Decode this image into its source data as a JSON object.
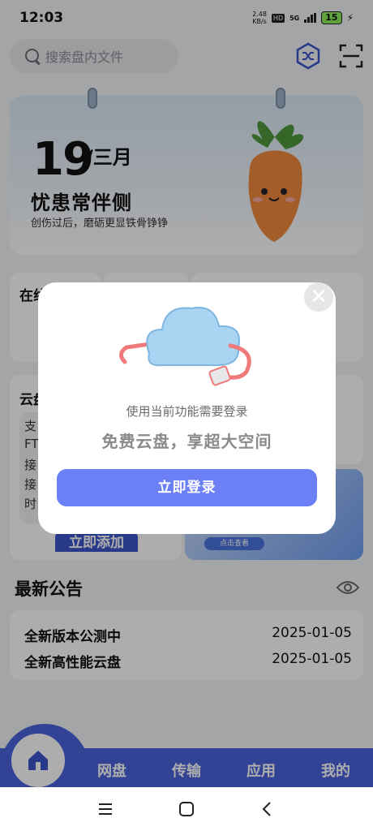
{
  "status_bar": {
    "time": "12:03",
    "speed_value": "2.48",
    "speed_unit": "KB/s",
    "hd": "HD",
    "network": "5G",
    "battery": "15"
  },
  "header": {
    "search_placeholder": "搜索盘内文件"
  },
  "calendar": {
    "day": "19",
    "month": "/三月",
    "title": "忧患常伴侧",
    "subtitle": "创伤过后，磨砺更显铁骨铮铮"
  },
  "background_cards": {
    "online_label": "在线",
    "cloud_label": "云盘",
    "side_lines": [
      "支",
      "FT",
      "接",
      "接",
      "时"
    ],
    "add_button": "立即添加",
    "promo_pill": "点击查看"
  },
  "announcements": {
    "title": "最新公告",
    "items": [
      {
        "title": "全新版本公测中",
        "date": "2025-01-05"
      },
      {
        "title": "全新高性能云盘",
        "date": "2025-01-05"
      }
    ]
  },
  "tabbar": {
    "tabs": [
      "网盘",
      "传输",
      "应用",
      "我的"
    ]
  },
  "modal": {
    "line1": "使用当前功能需要登录",
    "line2": "免费云盘，享超大空间",
    "login_button": "立即登录"
  },
  "colors": {
    "accent": "#4a63dc",
    "login_button": "#6c80f6"
  }
}
